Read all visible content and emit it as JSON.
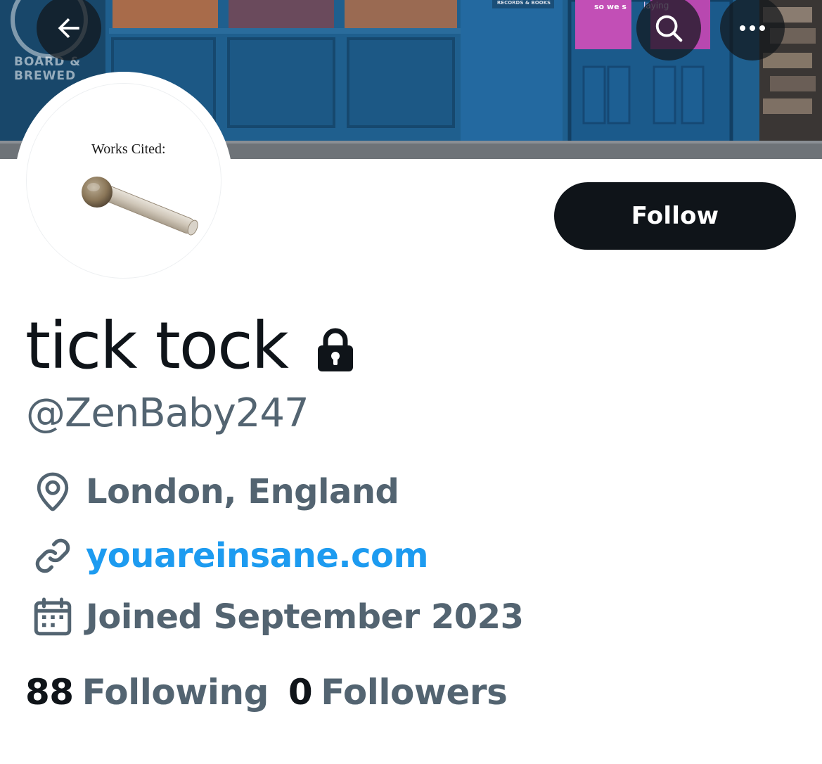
{
  "banner": {
    "logo_line1": "BOARD &",
    "logo_line2": "BREWED",
    "sign_text": "RECORDS & BOOKS",
    "neon_text_a": "so we s",
    "neon_text_b": "laying"
  },
  "nav": {
    "back_icon": "arrow-left-icon",
    "search_icon": "search-icon",
    "more_icon": "more-horizontal-icon"
  },
  "avatar": {
    "caption": "Works Cited:"
  },
  "profile": {
    "display_name": "tick tock",
    "handle": "@ZenBaby247",
    "protected": true,
    "location": "London, England",
    "website": "youareinsane.com",
    "joined": "Joined September 2023"
  },
  "actions": {
    "follow_label": "Follow"
  },
  "stats": {
    "following_count": "88",
    "following_label": "Following",
    "followers_count": "0",
    "followers_label": "Followers"
  },
  "colors": {
    "primary_text": "#0f1419",
    "secondary_text": "#536471",
    "link": "#1d9bf0",
    "button_bg": "#0f1419"
  }
}
